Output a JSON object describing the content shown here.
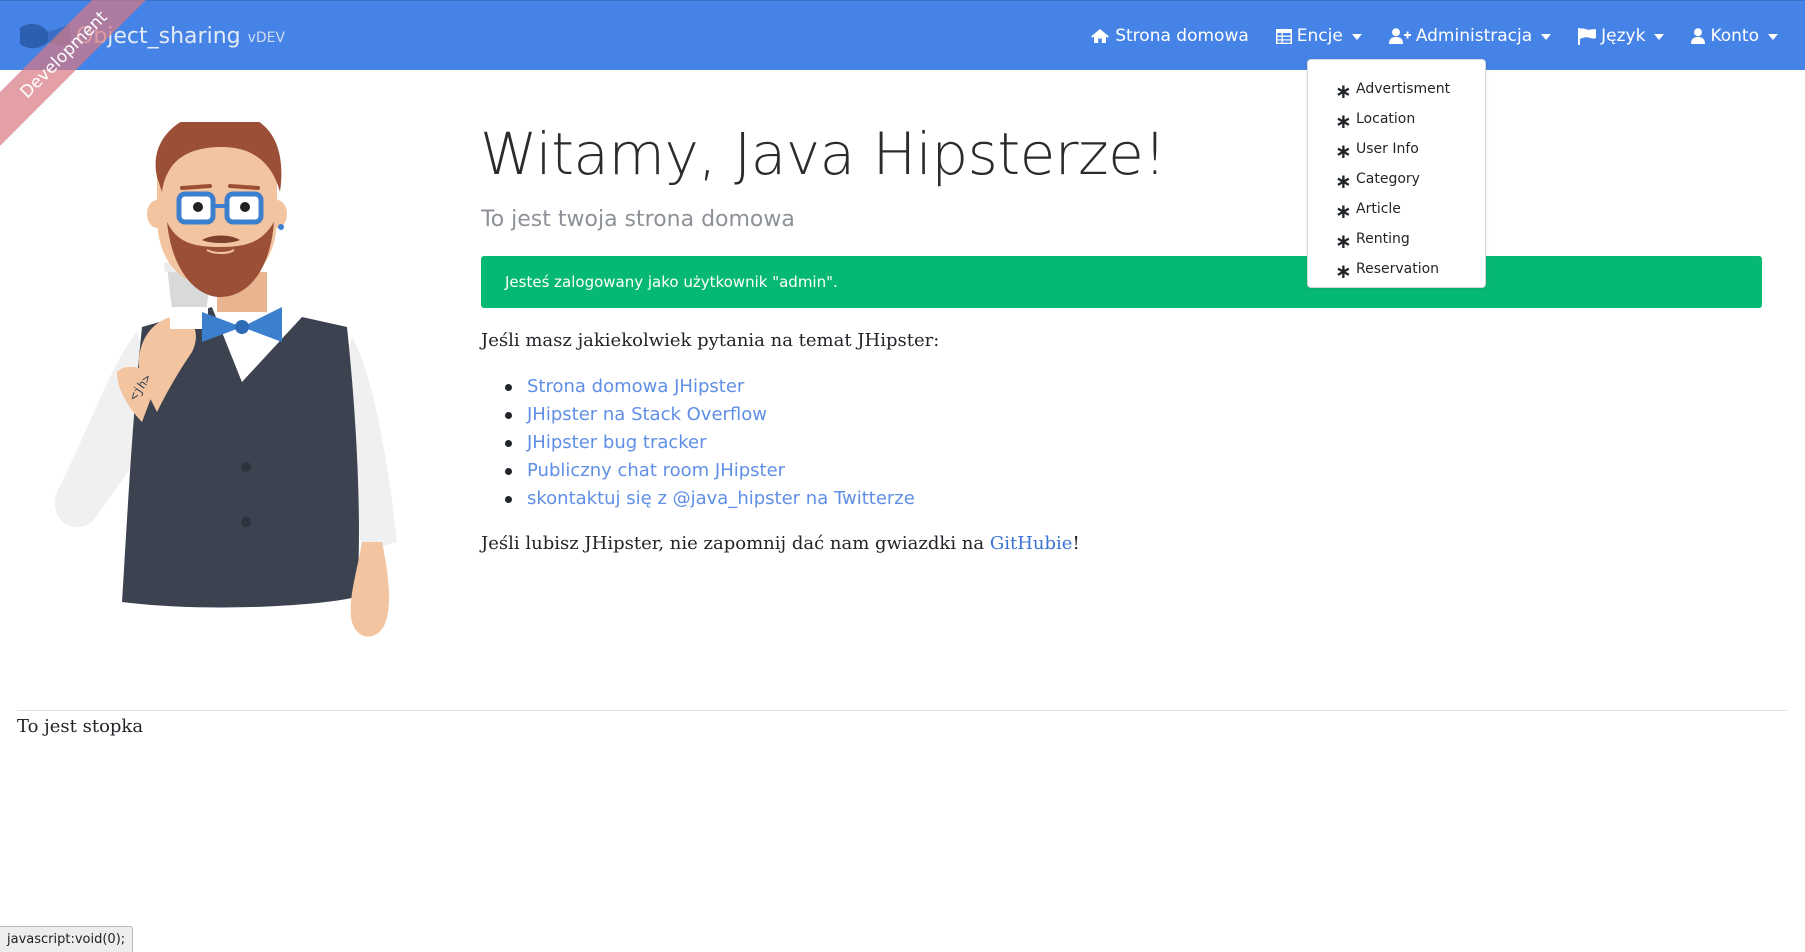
{
  "brand": {
    "name": "Object_sharing",
    "version": "vDEV",
    "ribbon": "Development"
  },
  "nav": {
    "home": "Strona domowa",
    "entities": "Encje",
    "admin": "Administracja",
    "language": "Język",
    "account": "Konto"
  },
  "entities_menu": {
    "items": [
      "Advertisment",
      "Location",
      "User Info",
      "Category",
      "Article",
      "Renting",
      "Reservation"
    ]
  },
  "main": {
    "title": "Witamy, Java Hipsterze!",
    "subtitle": "To jest twoja strona domowa",
    "alert": "Jesteś zalogowany jako użytkownik \"admin\".",
    "question": "Jeśli masz jakiekolwiek pytania na temat JHipster:",
    "links": [
      "Strona domowa JHipster",
      "JHipster na Stack Overflow",
      "JHipster bug tracker",
      "Publiczny chat room JHipster",
      "skontaktuj się z @java_hipster na Twitterze"
    ],
    "star_prefix": "Jeśli lubisz JHipster, nie zapomnij dać nam gwiazdki na ",
    "star_link": "GitHubie",
    "star_suffix": "!"
  },
  "footer": {
    "text": "To jest stopka"
  },
  "status_bar": {
    "text": "javascript:void(0);"
  },
  "colors": {
    "navbar": "#4683e6",
    "alert": "#06b973",
    "link": "#5f8fe6"
  },
  "icons": [
    "home-icon",
    "table-icon",
    "user-plus-icon",
    "flag-icon",
    "user-icon",
    "asterisk-icon"
  ]
}
